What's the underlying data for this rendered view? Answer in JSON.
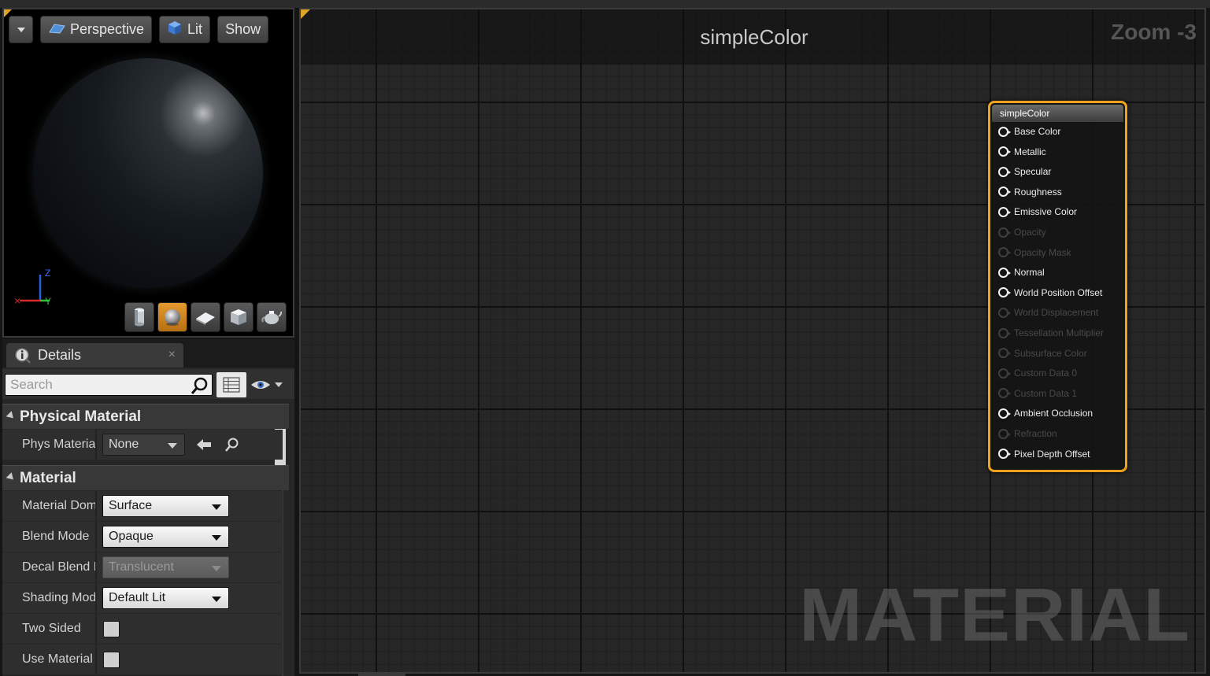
{
  "viewport": {
    "toolbar": {
      "perspective_label": "Perspective",
      "lit_label": "Lit",
      "show_label": "Show"
    },
    "axis": {
      "z": "Z",
      "y": "Y"
    },
    "preview_shapes": [
      "cylinder-icon",
      "sphere-icon",
      "plane-icon",
      "cube-icon",
      "teapot-icon"
    ],
    "active_shape": "sphere-icon"
  },
  "details": {
    "tab_title": "Details",
    "close_glyph": "×",
    "search_placeholder": "Search",
    "categories": {
      "physical_material": "Physical Material",
      "material": "Material"
    },
    "properties": {
      "phys_material": {
        "label": "Phys Material",
        "value": "None"
      },
      "material_domain": {
        "label": "Material Domain",
        "value": "Surface"
      },
      "blend_mode": {
        "label": "Blend Mode",
        "value": "Opaque"
      },
      "decal_blend": {
        "label": "Decal Blend Mode",
        "value": "Translucent"
      },
      "shading_model": {
        "label": "Shading Model",
        "value": "Default Lit"
      },
      "two_sided": {
        "label": "Two Sided",
        "checked": false
      },
      "use_material": {
        "label": "Use Material Attributes",
        "checked": false
      }
    }
  },
  "graph": {
    "title": "simpleColor",
    "zoom": "Zoom -3",
    "watermark": "MATERIAL",
    "node": {
      "title": "simpleColor",
      "pins": [
        {
          "label": "Base Color",
          "enabled": true
        },
        {
          "label": "Metallic",
          "enabled": true
        },
        {
          "label": "Specular",
          "enabled": true
        },
        {
          "label": "Roughness",
          "enabled": true
        },
        {
          "label": "Emissive Color",
          "enabled": true
        },
        {
          "label": "Opacity",
          "enabled": false
        },
        {
          "label": "Opacity Mask",
          "enabled": false
        },
        {
          "label": "Normal",
          "enabled": true
        },
        {
          "label": "World Position Offset",
          "enabled": true
        },
        {
          "label": "World Displacement",
          "enabled": false
        },
        {
          "label": "Tessellation Multiplier",
          "enabled": false
        },
        {
          "label": "Subsurface Color",
          "enabled": false
        },
        {
          "label": "Custom Data 0",
          "enabled": false
        },
        {
          "label": "Custom Data 1",
          "enabled": false
        },
        {
          "label": "Ambient Occlusion",
          "enabled": true
        },
        {
          "label": "Refraction",
          "enabled": false
        },
        {
          "label": "Pixel Depth Offset",
          "enabled": true
        }
      ]
    }
  },
  "colors": {
    "accent_orange": "#f0a21e",
    "graph_bg": "#262626",
    "panel_bg": "#262626"
  }
}
